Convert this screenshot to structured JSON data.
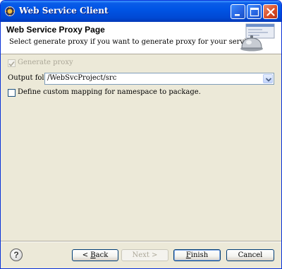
{
  "window": {
    "title": "Web Service Client"
  },
  "banner": {
    "title": "Web Service Proxy Page",
    "description": "Select generate proxy if you want to generate proxy for your service.",
    "graphic": "web-service-wizard-graphic"
  },
  "form": {
    "generate_proxy": {
      "label": "Generate proxy",
      "checked": true,
      "enabled": false
    },
    "output_folder": {
      "label": "Output folder",
      "value": "/WebSvcProject/src"
    },
    "custom_mapping": {
      "label": "Define custom mapping for namespace to package.",
      "checked": false
    }
  },
  "buttons": {
    "help_icon": "question-mark",
    "back": {
      "mnemonic": "B",
      "rest": "ack",
      "prefix": "< "
    },
    "next": {
      "label": "Next >",
      "enabled": false
    },
    "finish": {
      "mnemonic": "F",
      "rest": "inish"
    },
    "cancel": {
      "label": "Cancel"
    }
  },
  "colors": {
    "titlebar": "#0055e5",
    "dialog_background": "#ece9d8",
    "disabled_text": "#aca899"
  }
}
